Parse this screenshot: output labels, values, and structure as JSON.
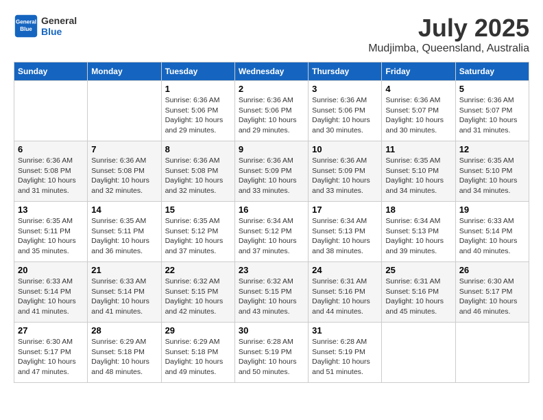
{
  "header": {
    "logo_general": "General",
    "logo_blue": "Blue",
    "month_title": "July 2025",
    "location": "Mudjimba, Queensland, Australia"
  },
  "days_of_week": [
    "Sunday",
    "Monday",
    "Tuesday",
    "Wednesday",
    "Thursday",
    "Friday",
    "Saturday"
  ],
  "weeks": [
    [
      {
        "day": "",
        "info": ""
      },
      {
        "day": "",
        "info": ""
      },
      {
        "day": "1",
        "info": "Sunrise: 6:36 AM\nSunset: 5:06 PM\nDaylight: 10 hours\nand 29 minutes."
      },
      {
        "day": "2",
        "info": "Sunrise: 6:36 AM\nSunset: 5:06 PM\nDaylight: 10 hours\nand 29 minutes."
      },
      {
        "day": "3",
        "info": "Sunrise: 6:36 AM\nSunset: 5:06 PM\nDaylight: 10 hours\nand 30 minutes."
      },
      {
        "day": "4",
        "info": "Sunrise: 6:36 AM\nSunset: 5:07 PM\nDaylight: 10 hours\nand 30 minutes."
      },
      {
        "day": "5",
        "info": "Sunrise: 6:36 AM\nSunset: 5:07 PM\nDaylight: 10 hours\nand 31 minutes."
      }
    ],
    [
      {
        "day": "6",
        "info": "Sunrise: 6:36 AM\nSunset: 5:08 PM\nDaylight: 10 hours\nand 31 minutes."
      },
      {
        "day": "7",
        "info": "Sunrise: 6:36 AM\nSunset: 5:08 PM\nDaylight: 10 hours\nand 32 minutes."
      },
      {
        "day": "8",
        "info": "Sunrise: 6:36 AM\nSunset: 5:08 PM\nDaylight: 10 hours\nand 32 minutes."
      },
      {
        "day": "9",
        "info": "Sunrise: 6:36 AM\nSunset: 5:09 PM\nDaylight: 10 hours\nand 33 minutes."
      },
      {
        "day": "10",
        "info": "Sunrise: 6:36 AM\nSunset: 5:09 PM\nDaylight: 10 hours\nand 33 minutes."
      },
      {
        "day": "11",
        "info": "Sunrise: 6:35 AM\nSunset: 5:10 PM\nDaylight: 10 hours\nand 34 minutes."
      },
      {
        "day": "12",
        "info": "Sunrise: 6:35 AM\nSunset: 5:10 PM\nDaylight: 10 hours\nand 34 minutes."
      }
    ],
    [
      {
        "day": "13",
        "info": "Sunrise: 6:35 AM\nSunset: 5:11 PM\nDaylight: 10 hours\nand 35 minutes."
      },
      {
        "day": "14",
        "info": "Sunrise: 6:35 AM\nSunset: 5:11 PM\nDaylight: 10 hours\nand 36 minutes."
      },
      {
        "day": "15",
        "info": "Sunrise: 6:35 AM\nSunset: 5:12 PM\nDaylight: 10 hours\nand 37 minutes."
      },
      {
        "day": "16",
        "info": "Sunrise: 6:34 AM\nSunset: 5:12 PM\nDaylight: 10 hours\nand 37 minutes."
      },
      {
        "day": "17",
        "info": "Sunrise: 6:34 AM\nSunset: 5:13 PM\nDaylight: 10 hours\nand 38 minutes."
      },
      {
        "day": "18",
        "info": "Sunrise: 6:34 AM\nSunset: 5:13 PM\nDaylight: 10 hours\nand 39 minutes."
      },
      {
        "day": "19",
        "info": "Sunrise: 6:33 AM\nSunset: 5:14 PM\nDaylight: 10 hours\nand 40 minutes."
      }
    ],
    [
      {
        "day": "20",
        "info": "Sunrise: 6:33 AM\nSunset: 5:14 PM\nDaylight: 10 hours\nand 41 minutes."
      },
      {
        "day": "21",
        "info": "Sunrise: 6:33 AM\nSunset: 5:14 PM\nDaylight: 10 hours\nand 41 minutes."
      },
      {
        "day": "22",
        "info": "Sunrise: 6:32 AM\nSunset: 5:15 PM\nDaylight: 10 hours\nand 42 minutes."
      },
      {
        "day": "23",
        "info": "Sunrise: 6:32 AM\nSunset: 5:15 PM\nDaylight: 10 hours\nand 43 minutes."
      },
      {
        "day": "24",
        "info": "Sunrise: 6:31 AM\nSunset: 5:16 PM\nDaylight: 10 hours\nand 44 minutes."
      },
      {
        "day": "25",
        "info": "Sunrise: 6:31 AM\nSunset: 5:16 PM\nDaylight: 10 hours\nand 45 minutes."
      },
      {
        "day": "26",
        "info": "Sunrise: 6:30 AM\nSunset: 5:17 PM\nDaylight: 10 hours\nand 46 minutes."
      }
    ],
    [
      {
        "day": "27",
        "info": "Sunrise: 6:30 AM\nSunset: 5:17 PM\nDaylight: 10 hours\nand 47 minutes."
      },
      {
        "day": "28",
        "info": "Sunrise: 6:29 AM\nSunset: 5:18 PM\nDaylight: 10 hours\nand 48 minutes."
      },
      {
        "day": "29",
        "info": "Sunrise: 6:29 AM\nSunset: 5:18 PM\nDaylight: 10 hours\nand 49 minutes."
      },
      {
        "day": "30",
        "info": "Sunrise: 6:28 AM\nSunset: 5:19 PM\nDaylight: 10 hours\nand 50 minutes."
      },
      {
        "day": "31",
        "info": "Sunrise: 6:28 AM\nSunset: 5:19 PM\nDaylight: 10 hours\nand 51 minutes."
      },
      {
        "day": "",
        "info": ""
      },
      {
        "day": "",
        "info": ""
      }
    ]
  ]
}
